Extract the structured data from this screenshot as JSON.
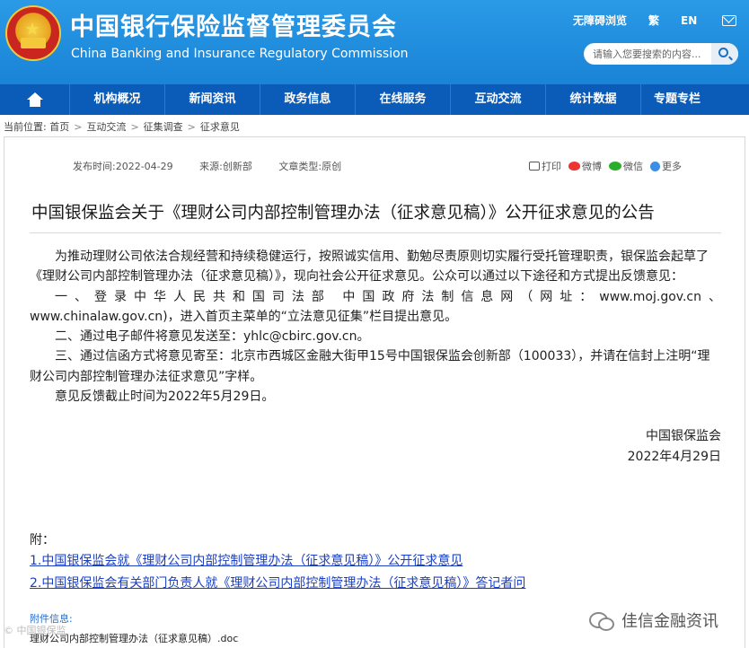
{
  "header": {
    "title_cn": "中国银行保险监督管理委员会",
    "title_en": "China Banking and Insurance Regulatory Commission",
    "links": [
      "无障碍浏览",
      "繁",
      "EN"
    ],
    "search_placeholder": "请输入您要搜索的内容..."
  },
  "nav": {
    "items": [
      "机构概况",
      "新闻资讯",
      "政务信息",
      "在线服务",
      "互动交流",
      "统计数据",
      "专题专栏"
    ]
  },
  "breadcrumb": {
    "label": "当前位置:",
    "items": [
      "首页",
      "互动交流",
      "征集调查",
      "征求意见"
    ]
  },
  "article": {
    "meta": {
      "date": "发布时间:2022-04-29",
      "source": "来源:创新部",
      "type": "文章类型:原创"
    },
    "share": [
      "打印",
      "微博",
      "微信",
      "更多"
    ],
    "title": "中国银保监会关于《理财公司内部控制管理办法（征求意见稿）》公开征求意见的公告",
    "paragraphs": [
      "为推动理财公司依法合规经营和持续稳健运行，按照诚实信用、勤勉尽责原则切实履行受托管理职责，银保监会起草了《理财公司内部控制管理办法（征求意见稿）》，现向社会公开征求意见。公众可以通过以下途径和方式提出反馈意见：",
      "一、登录中华人民共和国司法部  中国政府法制信息网（网址：www.moj.gov.cn、",
      "www.chinalaw.gov.cn)，进入首页主菜单的“立法意见征集”栏目提出意见。",
      "二、通过电子邮件将意见发送至：yhlc@cbirc.gov.cn。",
      "三、通过信函方式将意见寄至：北京市西城区金融大街甲15号中国银保监会创新部（100033），并请在信封上注明“理财公司内部控制管理办法征求意见”字样。",
      "意见反馈截止时间为2022年5月29日。"
    ],
    "signature": "中国银保监会",
    "sign_date": "2022年4月29日",
    "attachments_label": "附：",
    "attachments": [
      "1.中国银保监会就《理财公司内部控制管理办法（征求意见稿）》公开征求意见",
      "2.中国银保监会有关部门负责人就《理财公司内部控制管理办法（征求意见稿）》答记者问"
    ],
    "files_label": "附件信息:",
    "files": [
      "理财公司内部控制管理办法（征求意见稿）.doc"
    ]
  },
  "overlay": {
    "badge": "佳信金融资讯",
    "watermark": "©  中国银保监"
  }
}
